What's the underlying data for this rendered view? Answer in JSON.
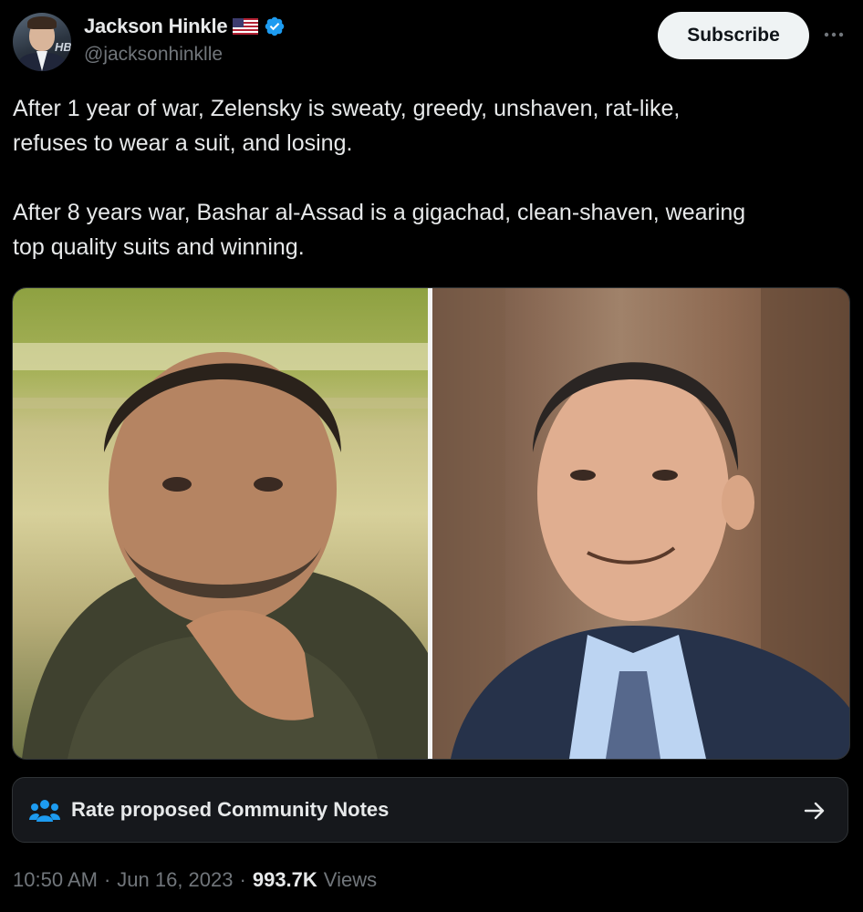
{
  "author": {
    "display_name": "Jackson Hinkle",
    "handle": "@jacksonhinklle",
    "avatar_badge_text": "HB",
    "flag_icon": "us-flag-icon",
    "verified_icon": "verified-badge-icon"
  },
  "header": {
    "subscribe_label": "Subscribe",
    "more_icon": "more-options-icon"
  },
  "tweet": {
    "text": "After 1 year of war, Zelensky is sweaty, greedy, unshaven, rat-like,\nrefuses to wear a suit, and losing.\n\nAfter 8 years war, Bashar al-Assad is a gigachad, clean-shaven, wearing\ntop quality suits and winning."
  },
  "media": {
    "left_photo": "zelensky-photo",
    "right_photo": "assad-photo"
  },
  "community_notes": {
    "label": "Rate proposed Community Notes",
    "icon": "people-icon",
    "arrow_icon": "arrow-right-icon"
  },
  "meta": {
    "time": "10:50 AM",
    "separator1": "·",
    "date": "Jun 16, 2023",
    "separator2": "·",
    "views_count": "993.7K",
    "views_label": "Views"
  },
  "colors": {
    "background": "#000000",
    "text_primary": "#e7e9ea",
    "text_secondary": "#71767b",
    "verified_blue": "#1d9bf0",
    "button_bg": "#eff3f4"
  }
}
